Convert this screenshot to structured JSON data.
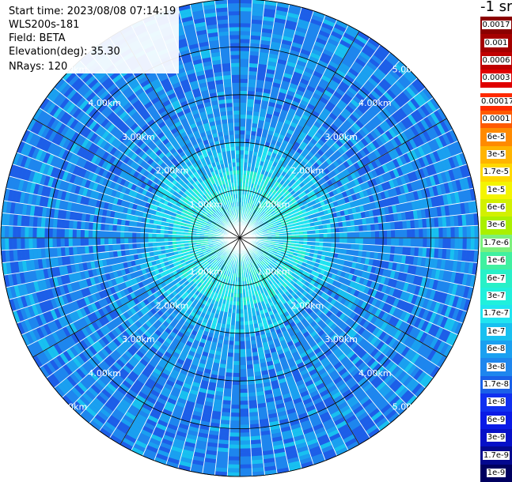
{
  "info": {
    "start_time": "Start time: 2023/08/08 07:14:19",
    "instrument": "WLS200s-181",
    "field": "Field: BETA",
    "elevation": "Elevation(deg): 35.30",
    "nrays": "NRays: 120"
  },
  "colorbar": {
    "units_label": "-1 sr",
    "levels": [
      {
        "label": "0.0017",
        "color": "#8b0000"
      },
      {
        "label": "0.001",
        "color": "#a50000"
      },
      {
        "label": "0.0006",
        "color": "#c00000"
      },
      {
        "label": "0.0003",
        "color": "#e00000"
      },
      {
        "label": "0.00017",
        "color": "#ff2a00"
      },
      {
        "label": "0.0001",
        "color": "#ff5a00"
      },
      {
        "label": "6e-5",
        "color": "#ff8a00"
      },
      {
        "label": "3e-5",
        "color": "#ffb400"
      },
      {
        "label": "1.7e-5",
        "color": "#ffd800"
      },
      {
        "label": "1e-5",
        "color": "#f4f400"
      },
      {
        "label": "6e-6",
        "color": "#d2f000"
      },
      {
        "label": "3e-6",
        "color": "#aaf000"
      },
      {
        "label": "1.7e-6",
        "color": "#7cf07c"
      },
      {
        "label": "1e-6",
        "color": "#40f0a0"
      },
      {
        "label": "6e-7",
        "color": "#28f0c8"
      },
      {
        "label": "3e-7",
        "color": "#20f0dc"
      },
      {
        "label": "1.7e-7",
        "color": "#20e4f0"
      },
      {
        "label": "1e-7",
        "color": "#18c0f0"
      },
      {
        "label": "6e-8",
        "color": "#1aa0f0"
      },
      {
        "label": "3e-8",
        "color": "#1e86ee"
      },
      {
        "label": "1.7e-8",
        "color": "#1a60e8"
      },
      {
        "label": "1e-8",
        "color": "#1030f0"
      },
      {
        "label": "6e-9",
        "color": "#0a1ae6"
      },
      {
        "label": "3e-9",
        "color": "#0610c8"
      },
      {
        "label": "1.7e-9",
        "color": "#04088e"
      },
      {
        "label": "1e-9",
        "color": "#000060"
      }
    ]
  },
  "chart_data": {
    "type": "heatmap",
    "projection": "polar (PPI scan)",
    "field": "BETA",
    "elevation_deg": 35.3,
    "n_rays": 120,
    "range_ring_labels": [
      "1.00km",
      "2.00km",
      "3.00km",
      "4.00km",
      "5.00km"
    ],
    "range_rings_km": [
      1,
      2,
      3,
      4,
      5
    ],
    "max_range_km": 5.0,
    "azimuth_spokes_deg": [
      0,
      30,
      60,
      90,
      120,
      150,
      180,
      210,
      240,
      270,
      300,
      330
    ],
    "color_scale": "log",
    "value_profile_by_range": [
      {
        "range_km": 0.5,
        "beta": 3e-07
      },
      {
        "range_km": 1.0,
        "beta": 3e-07
      },
      {
        "range_km": 1.5,
        "beta": 1.7e-07
      },
      {
        "range_km": 2.0,
        "beta": 6e-08
      },
      {
        "range_km": 3.0,
        "beta": 3e-08
      },
      {
        "range_km": 4.0,
        "beta": 3e-08
      },
      {
        "range_km": 5.0,
        "beta": 3e-08
      }
    ]
  }
}
